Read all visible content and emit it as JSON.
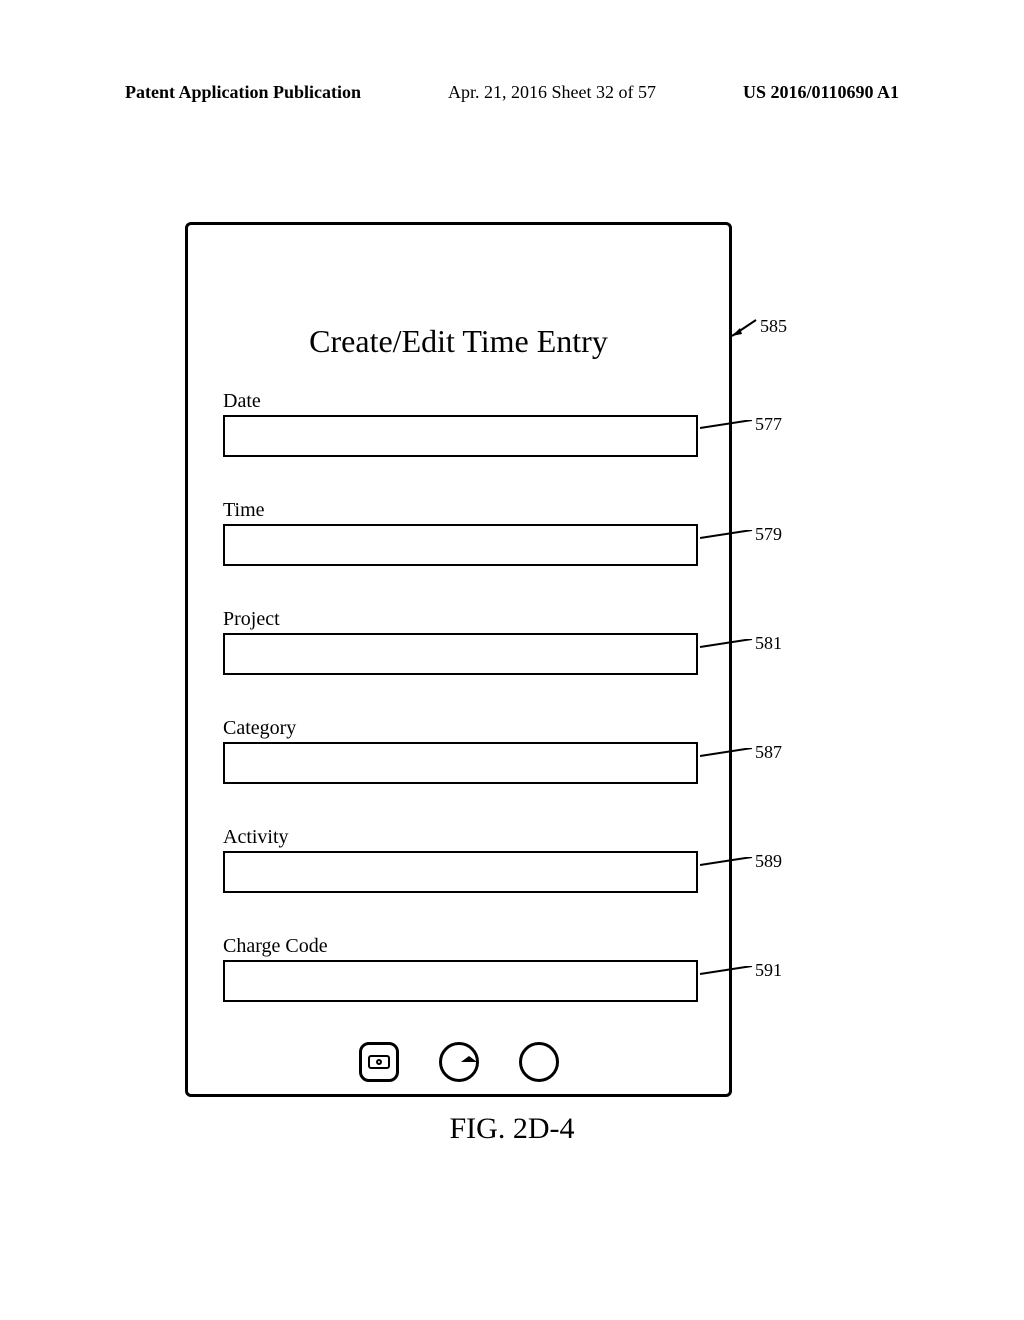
{
  "header": {
    "left": "Patent Application Publication",
    "center": "Apr. 21, 2016  Sheet 32 of 57",
    "right": "US 2016/0110690 A1"
  },
  "form": {
    "title": "Create/Edit Time Entry",
    "fields": {
      "date": {
        "label": "Date",
        "value": ""
      },
      "time": {
        "label": "Time",
        "value": ""
      },
      "project": {
        "label": "Project",
        "value": ""
      },
      "category": {
        "label": "Category",
        "value": ""
      },
      "activity": {
        "label": "Activity",
        "value": ""
      },
      "charge_code": {
        "label": "Charge Code",
        "value": ""
      }
    }
  },
  "callouts": {
    "c585": "585",
    "c577": "577",
    "c579": "579",
    "c581": "581",
    "c587": "587",
    "c589": "589",
    "c591": "591"
  },
  "figure_caption": "FIG. 2D-4"
}
